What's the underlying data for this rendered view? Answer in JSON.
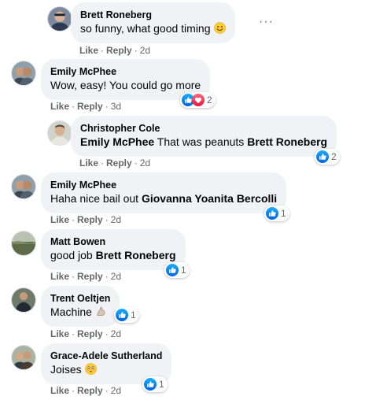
{
  "comments": [
    {
      "author": "Brett Roneberg",
      "text": "so funny, what good timing",
      "emoji": "smile-emoji",
      "like": "Like",
      "reply": "Reply",
      "sep": "·",
      "time": "2d",
      "more": "···"
    },
    {
      "author": "Emily McPhee",
      "text": "Wow, easy! You could go more",
      "like": "Like",
      "reply": "Reply",
      "sep": "·",
      "time": "3d",
      "reactions": {
        "icons": [
          "like-icon",
          "love-icon"
        ],
        "count": "2"
      }
    },
    {
      "author": "Christopher Cole",
      "tag1": "Emily McPhee",
      "text": "That was peanuts",
      "tag2": "Brett Roneberg",
      "like": "Like",
      "reply": "Reply",
      "sep": "·",
      "time": "2d",
      "reactions": {
        "icons": [
          "like-icon"
        ],
        "count": "2"
      }
    },
    {
      "author": "Emily McPhee",
      "text": "Haha nice bail out",
      "tag1": "Giovanna Yoanita Bercolli",
      "like": "Like",
      "reply": "Reply",
      "sep": "·",
      "time": "2d",
      "reactions": {
        "icons": [
          "like-icon"
        ],
        "count": "1"
      }
    },
    {
      "author": "Matt Bowen",
      "text": "good job",
      "tag1": "Brett Roneberg",
      "like": "Like",
      "reply": "Reply",
      "sep": "·",
      "time": "2d",
      "reactions": {
        "icons": [
          "like-icon"
        ],
        "count": "1"
      }
    },
    {
      "author": "Trent Oeltjen",
      "text": "Machine",
      "emoji": "flexed-arm-emoji",
      "like": "Like",
      "reply": "Reply",
      "sep": "·",
      "time": "2d",
      "reactions": {
        "icons": [
          "like-icon"
        ],
        "count": "1"
      }
    },
    {
      "author": "Grace-Adele Sutherland",
      "text": "Joises",
      "emoji": "flushed-face-emoji",
      "like": "Like",
      "reply": "Reply",
      "sep": "·",
      "time": "2d",
      "reactions": {
        "icons": [
          "like-icon"
        ],
        "count": "1"
      }
    }
  ],
  "colors": {
    "bubble": "#f0f2f5",
    "meta_text": "#65676b",
    "like_blue": "#1877f2",
    "love_red": "#f33e58"
  }
}
